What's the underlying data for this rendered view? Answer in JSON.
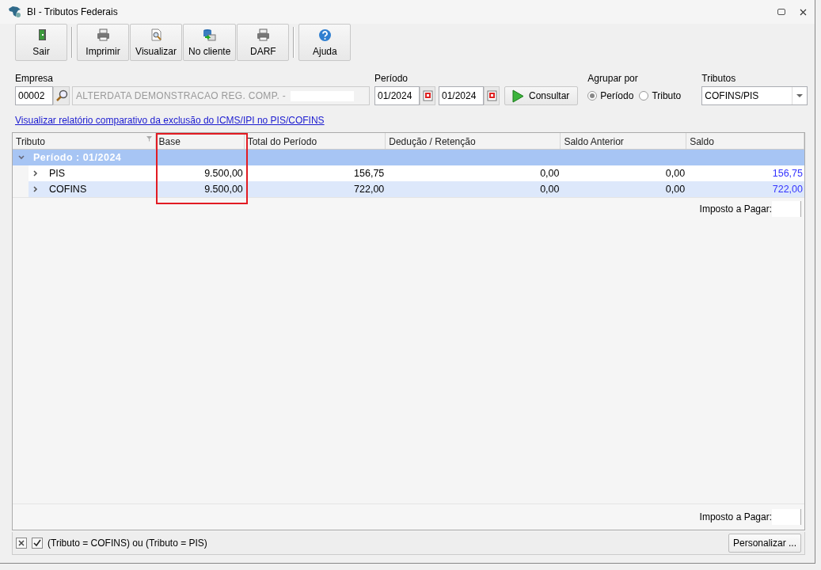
{
  "window": {
    "title": "BI - Tributos Federais"
  },
  "toolbar": [
    [
      {
        "label": "Sair",
        "kind": "exit"
      }
    ],
    [
      {
        "label": "Imprimir",
        "kind": "printer"
      },
      {
        "label": "Visualizar",
        "kind": "preview"
      },
      {
        "label": "No cliente",
        "kind": "client"
      },
      {
        "label": "DARF",
        "kind": "printer"
      }
    ],
    [
      {
        "label": "Ajuda",
        "kind": "help"
      }
    ]
  ],
  "empresa": {
    "label": "Empresa",
    "code": "00002",
    "name": "ALTERDATA DEMONSTRACAO REG. COMP. -"
  },
  "periodo": {
    "label": "Período",
    "from": "01/2024",
    "to": "01/2024"
  },
  "consultar_button": "Consultar",
  "agrupar": {
    "label": "Agrupar por",
    "options": [
      {
        "label": "Período",
        "selected": true
      },
      {
        "label": "Tributo",
        "selected": false
      }
    ]
  },
  "tributos": {
    "label": "Tributos",
    "value": "COFINS/PIS"
  },
  "report_link": "Visualizar relatório comparativo da exclusão do ICMS/IPI no PIS/COFINS",
  "table": {
    "columns": [
      {
        "label": "Tributo",
        "highlighted": false,
        "kind": "name"
      },
      {
        "label": "Base",
        "highlighted": true,
        "kind": "amount"
      },
      {
        "label": "Total do Período",
        "highlighted": false,
        "kind": "amount"
      },
      {
        "label": "Dedução / Retenção",
        "highlighted": false,
        "kind": "amount"
      },
      {
        "label": "Saldo Anterior",
        "highlighted": false,
        "kind": "amount"
      },
      {
        "label": "Saldo",
        "highlighted": false,
        "kind": "balance"
      }
    ],
    "groups": [
      {
        "label": "Período : 01/2024",
        "expanded": true,
        "rows": [
          {
            "expanded": false,
            "cells": [
              "PIS",
              "9.500,00",
              "156,75",
              "0,00",
              "0,00",
              "156,75"
            ]
          },
          {
            "expanded": false,
            "cells": [
              "COFINS",
              "9.500,00",
              "722,00",
              "0,00",
              "0,00",
              "722,00"
            ]
          }
        ],
        "footer_label": "Imposto a Pagar:"
      }
    ],
    "footer_label": "Imposto a Pagar:"
  },
  "filter": {
    "enabled": true,
    "text": "(Tributo = COFINS) ou (Tributo = PIS)"
  },
  "customize_button": "Personalizar ..."
}
